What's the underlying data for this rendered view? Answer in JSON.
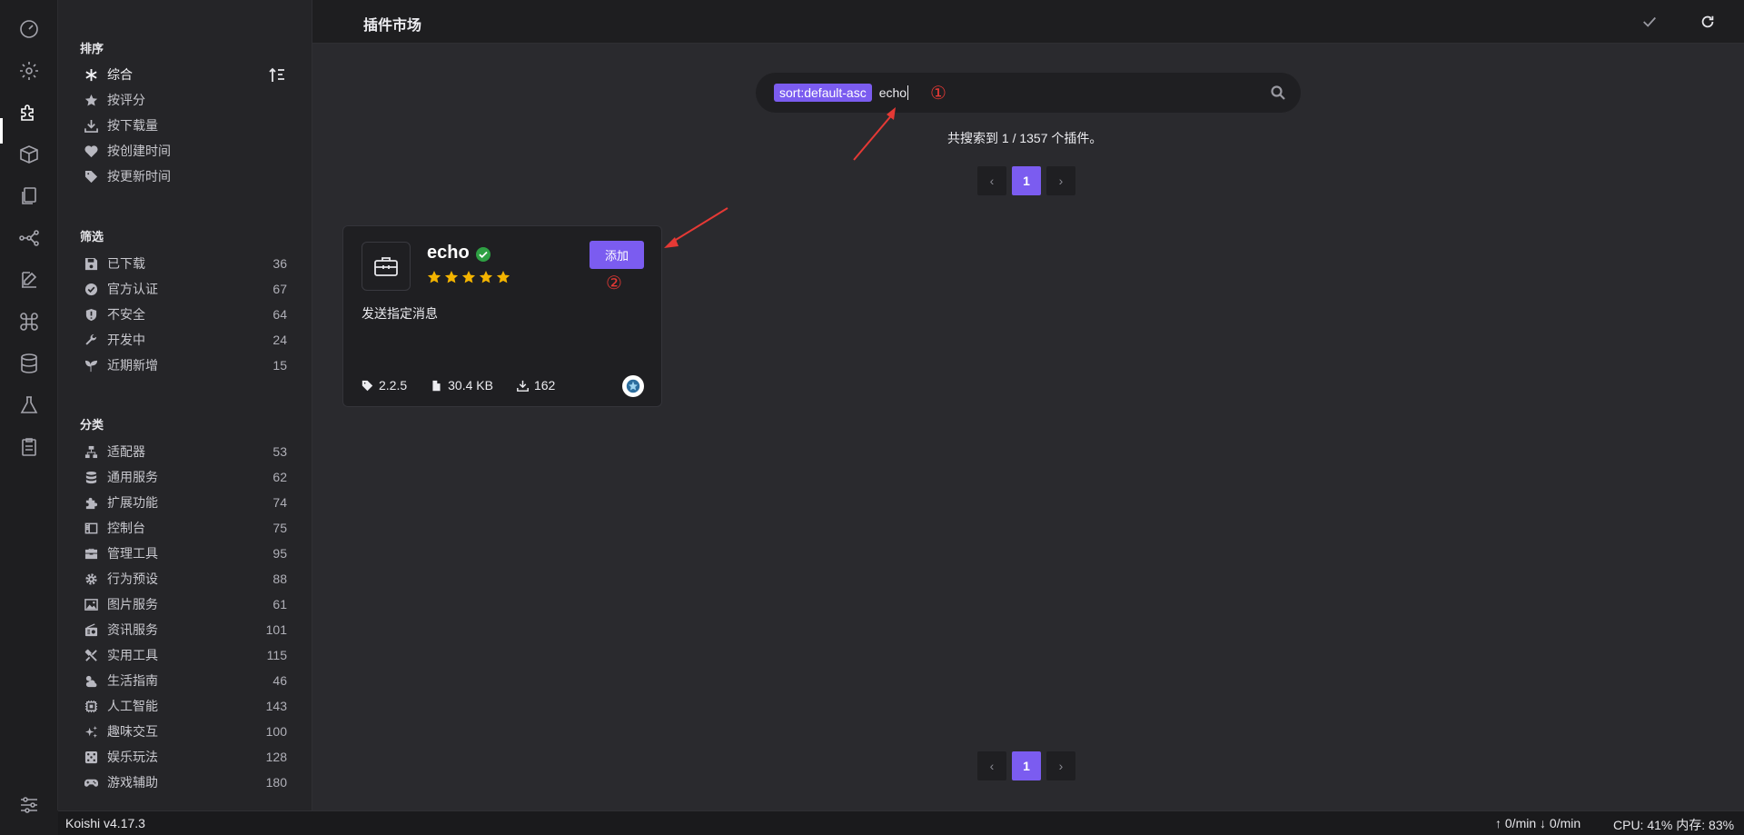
{
  "header": {
    "title": "插件市场"
  },
  "sidebar": {
    "sort": {
      "title": "排序",
      "items": [
        {
          "label": "综合",
          "icon": "asterisk-icon"
        },
        {
          "label": "按评分",
          "icon": "star-icon"
        },
        {
          "label": "按下载量",
          "icon": "download-icon"
        },
        {
          "label": "按创建时间",
          "icon": "heartbeat-icon"
        },
        {
          "label": "按更新时间",
          "icon": "tag-icon"
        }
      ]
    },
    "filter": {
      "title": "筛选",
      "items": [
        {
          "label": "已下载",
          "count": "36",
          "icon": "save-icon"
        },
        {
          "label": "官方认证",
          "count": "67",
          "icon": "check-circle-icon"
        },
        {
          "label": "不安全",
          "count": "64",
          "icon": "shield-exclamation-icon"
        },
        {
          "label": "开发中",
          "count": "24",
          "icon": "wrench-icon"
        },
        {
          "label": "近期新增",
          "count": "15",
          "icon": "seedling-icon"
        }
      ]
    },
    "category": {
      "title": "分类",
      "items": [
        {
          "label": "适配器",
          "count": "53",
          "icon": "network-icon"
        },
        {
          "label": "通用服务",
          "count": "62",
          "icon": "database-icon"
        },
        {
          "label": "扩展功能",
          "count": "74",
          "icon": "puzzle-icon"
        },
        {
          "label": "控制台",
          "count": "75",
          "icon": "window-icon"
        },
        {
          "label": "管理工具",
          "count": "95",
          "icon": "toolbox-icon"
        },
        {
          "label": "行为预设",
          "count": "88",
          "icon": "cog-icon"
        },
        {
          "label": "图片服务",
          "count": "61",
          "icon": "image-icon"
        },
        {
          "label": "资讯服务",
          "count": "101",
          "icon": "radio-icon"
        },
        {
          "label": "实用工具",
          "count": "115",
          "icon": "tools-icon"
        },
        {
          "label": "生活指南",
          "count": "46",
          "icon": "cloud-sun-icon"
        },
        {
          "label": "人工智能",
          "count": "143",
          "icon": "chip-icon"
        },
        {
          "label": "趣味交互",
          "count": "100",
          "icon": "sparkles-icon"
        },
        {
          "label": "娱乐玩法",
          "count": "128",
          "icon": "dice-icon"
        },
        {
          "label": "游戏辅助",
          "count": "180",
          "icon": "gamepad-icon"
        }
      ]
    }
  },
  "search": {
    "tag": "sort:default-asc",
    "query": "echo"
  },
  "annotations": {
    "first": "①",
    "second": "②"
  },
  "result": {
    "text": "共搜索到 1 / 1357 个插件。"
  },
  "pager": {
    "prev": "‹",
    "current": "1",
    "next": "›"
  },
  "card": {
    "name": "echo",
    "rating": 5,
    "add_label": "添加",
    "description": "发送指定消息",
    "version": "2.2.5",
    "size": "30.4 KB",
    "downloads": "162"
  },
  "status": {
    "version": "Koishi v4.17.3",
    "network": "↑ 0/min ↓ 0/min",
    "cpu": "CPU: 41% 内存: 83%"
  },
  "colors": {
    "accent": "#7b5cf0",
    "star": "#f4b400",
    "verified": "#2ea043",
    "annotation": "#e53935"
  }
}
